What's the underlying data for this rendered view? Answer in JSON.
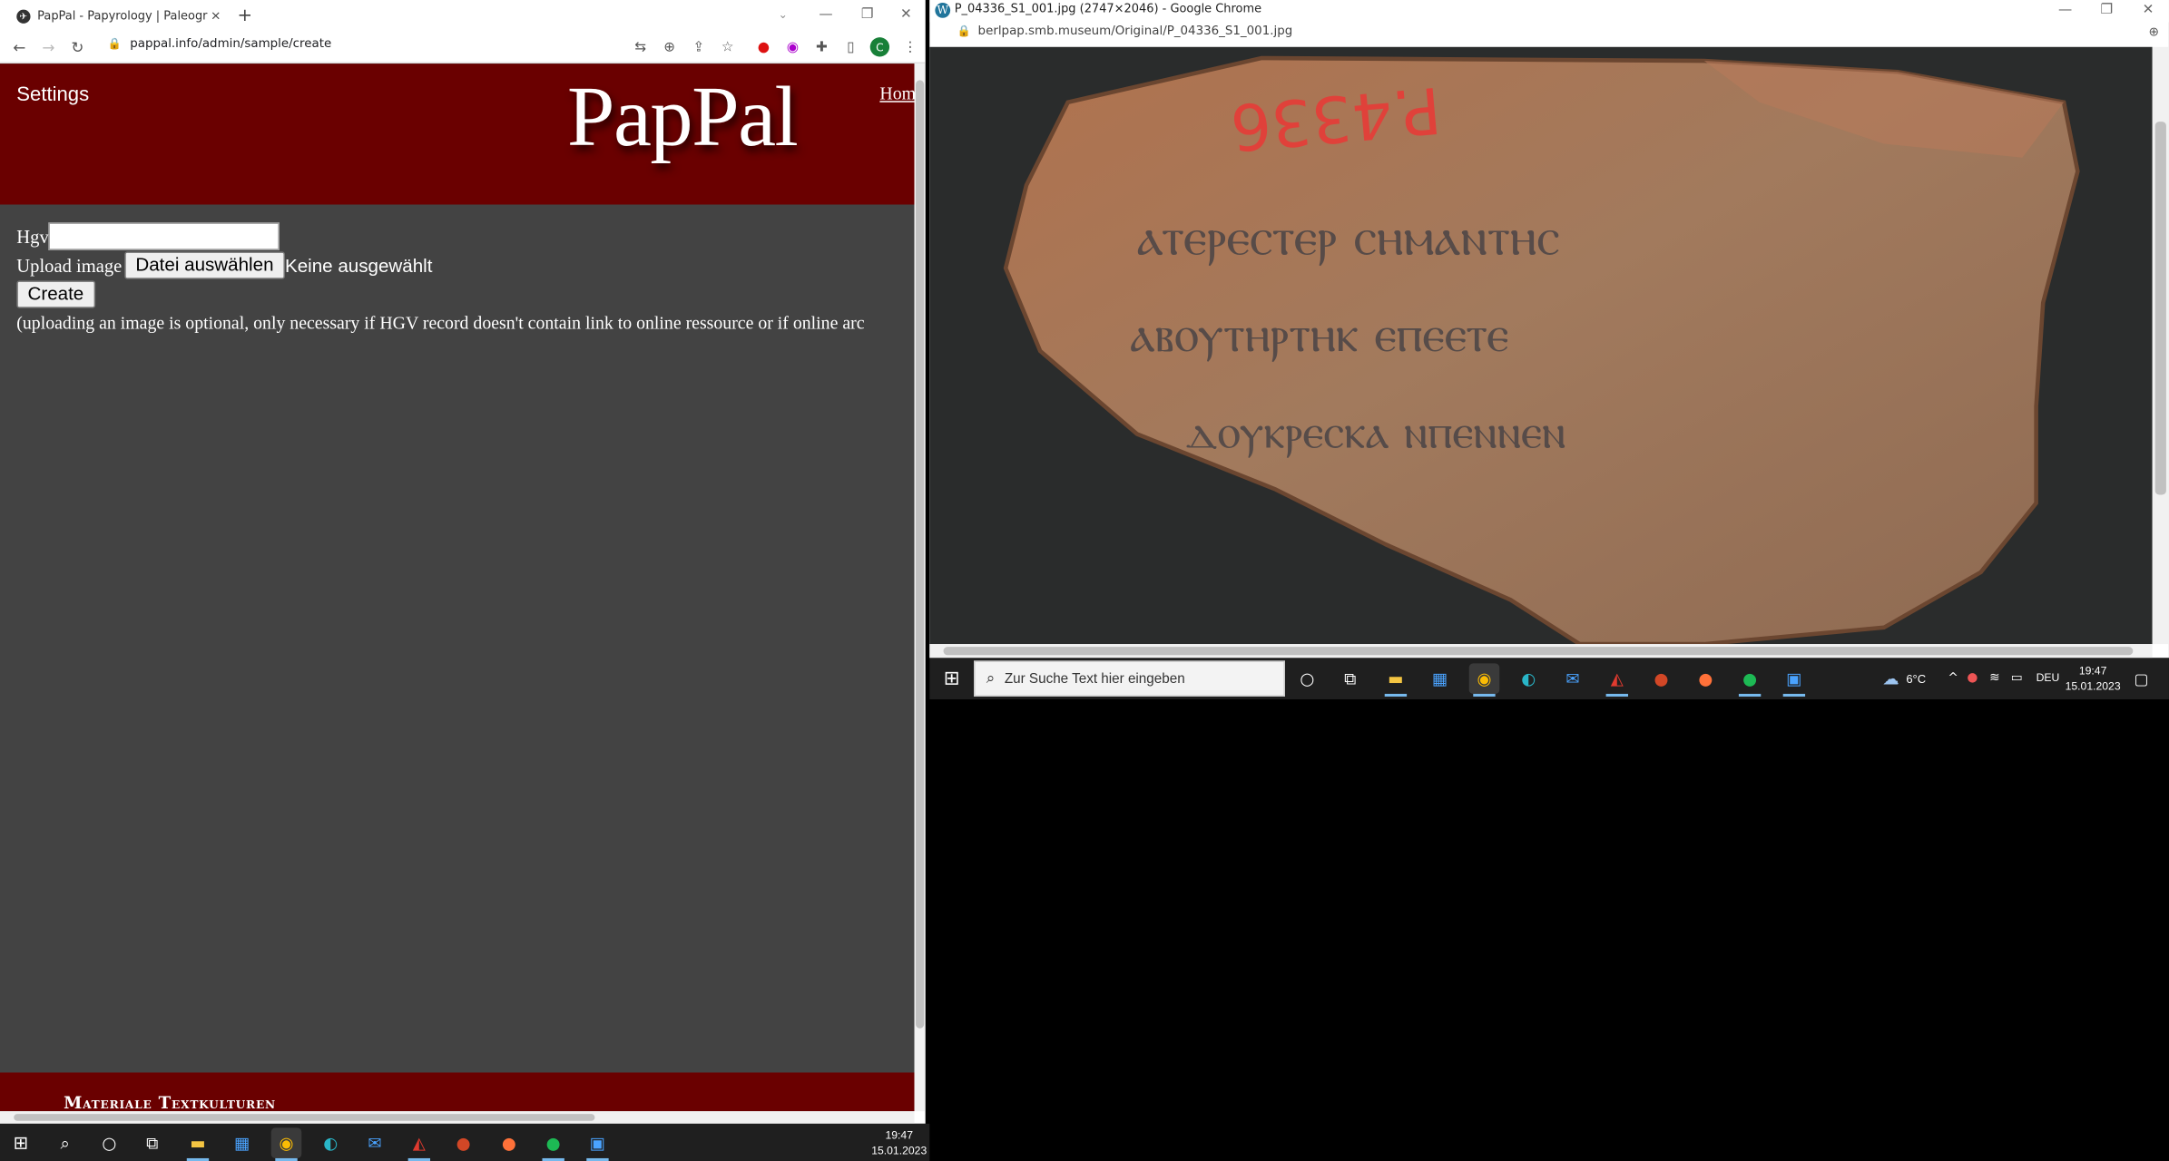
{
  "left_window": {
    "tab_title": "PapPal - Papyrology | Paleograph",
    "tab_close": "×",
    "new_tab": "+",
    "address": "pappal.info/admin/sample/create",
    "page": {
      "settings": "Settings",
      "logo": "PapPal",
      "home_link": "Hom",
      "hgv_label": "Hgv",
      "hgv_value": "",
      "upload_label": "Upload image",
      "file_button": "Datei auswählen",
      "file_status": "Keine ausgewählt",
      "create_button": "Create",
      "note": "(uploading an image is optional, only necessary if HGV record doesn't contain link to online ressource or if online arc",
      "footer_text": "Materiale Textkulturen"
    },
    "profile_initial": "C"
  },
  "right_window": {
    "title": "P_04336_S1_001.jpg (2747×2046) - Google Chrome",
    "address": "berlpap.smb.museum/Original/P_04336_S1_001.jpg",
    "image_label": "P.4336",
    "inscription_lines": [
      "ⲁⲧⲉⲣⲉⲥⲧⲉⲣ ⲥⲏⲙⲁⲛⲧⲏⲥ",
      "ⲁⲃⲟⲩⲧⲏⲣⲧⲏⲕ ⲉⲡⲉⲉⲧⲉ",
      "ⲇⲟⲩⲕⲣⲉⲥⲕⲁ ⲛⲡⲉⲛⲛⲉⲛ"
    ]
  },
  "taskbar_right": {
    "search_placeholder": "Zur Suche Text hier eingeben",
    "weather": "6°C",
    "language": "DEU",
    "time": "19:47",
    "date": "15.01.2023"
  },
  "taskbar_left": {
    "time": "19:47",
    "date": "15.01.2023"
  },
  "colors": {
    "banner": "#6a0000",
    "page_bg": "#434343",
    "taskbar": "#1f1f1f"
  }
}
